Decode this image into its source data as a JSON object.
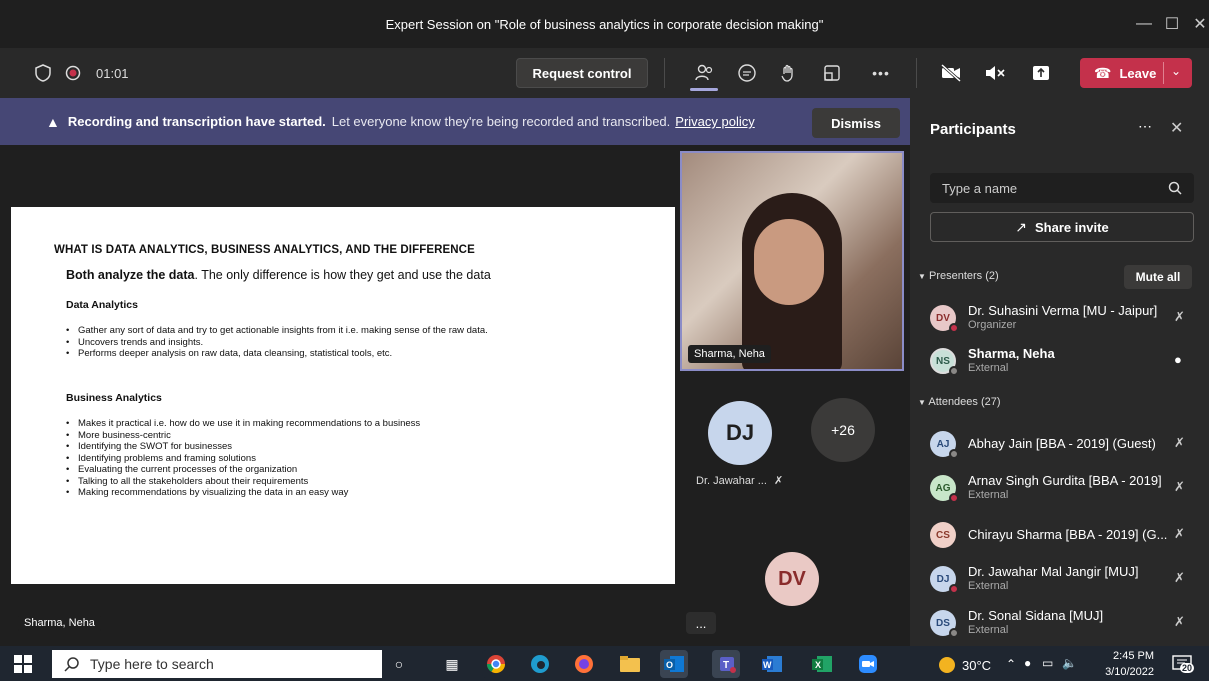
{
  "window": {
    "title": "Expert Session on \"Role of business analytics in corporate decision making\""
  },
  "toolbar": {
    "timer": "01:01",
    "request_control": "Request control",
    "leave": "Leave"
  },
  "banner": {
    "bold": "Recording and transcription have started.",
    "text": "Let everyone know they're being recorded and transcribed.",
    "link": "Privacy policy",
    "dismiss": "Dismiss"
  },
  "slide": {
    "title": "WHAT IS DATA ANALYTICS, BUSINESS ANALYTICS, AND THE DIFFERENCE",
    "subtitle_bold": "Both analyze the data",
    "subtitle_rest": ". The only difference is how they get and use the data",
    "sections": [
      {
        "heading": "Data Analytics",
        "items": [
          "Gather any sort of data and try to get actionable insights from it i.e. making sense of the raw data.",
          "Uncovers trends and insights.",
          "Performs deeper analysis on raw data, data cleansing, statistical tools, etc."
        ]
      },
      {
        "heading": "Business Analytics",
        "items": [
          "Makes it practical i.e. how do we use it in making recommendations to a business",
          "More business-centric",
          "Identifying the SWOT for businesses",
          "Identifying problems and framing solutions",
          "Evaluating the current processes of the organization",
          "Talking to all the stakeholders about their requirements",
          "Making recommendations by visualizing the data in an easy way"
        ]
      }
    ]
  },
  "stage": {
    "presenter_name": "Sharma, Neha"
  },
  "videos": {
    "main_name": "Sharma, Neha",
    "dj_initials": "DJ",
    "dj_name": "Dr. Jawahar ...",
    "more_count": "+26",
    "dv_initials": "DV",
    "more_menu": "..."
  },
  "panel": {
    "title": "Participants",
    "search_placeholder": "Type a name",
    "share_invite": "Share invite",
    "presenters_label": "Presenters (2)",
    "mute_all": "Mute all",
    "attendees_label": "Attendees (27)",
    "presenters": [
      {
        "initials": "DV",
        "name": "Dr. Suhasini Verma [MU - Jaipur]",
        "role": "Organizer",
        "color": "#e8c8c8",
        "status": "#c4314b",
        "mic": "muted"
      },
      {
        "initials": "NS",
        "name": "Sharma, Neha",
        "role": "External",
        "color": "#c8e0d8",
        "status": "#8a8886",
        "mic": "on"
      }
    ],
    "attendees": [
      {
        "initials": "AJ",
        "name": "Abhay Jain [BBA - 2019] (Guest)",
        "role": "",
        "color": "#c7d6ec",
        "status": "#8a8886"
      },
      {
        "initials": "AG",
        "name": "Arnav Singh Gurdita [BBA - 2019]",
        "role": "External",
        "color": "#c8e6c9",
        "status": "#c4314b"
      },
      {
        "initials": "CS",
        "name": "Chirayu Sharma [BBA - 2019] (G...",
        "role": "",
        "color": "#f0d0c8",
        "status": ""
      },
      {
        "initials": "DJ",
        "name": "Dr. Jawahar Mal Jangir [MUJ]",
        "role": "External",
        "color": "#c7d6ec",
        "status": "#c4314b"
      },
      {
        "initials": "DS",
        "name": "Dr. Sonal Sidana [MUJ]",
        "role": "External",
        "color": "#c7d6ec",
        "status": "#8a8886"
      }
    ]
  },
  "taskbar": {
    "search_placeholder": "Type here to search",
    "temperature": "30°C",
    "time": "2:45 PM",
    "date": "3/10/2022",
    "notifications": "20"
  }
}
